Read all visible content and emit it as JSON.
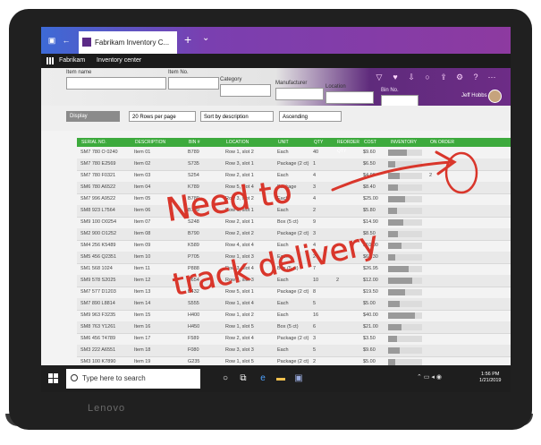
{
  "device": {
    "brand": "Lenovo"
  },
  "browser": {
    "tab_title": "Fabrikam Inventory C...",
    "new_tab": "+",
    "tab_list": "⌄"
  },
  "app": {
    "name": "Fabrikam",
    "page": "Inventory center"
  },
  "filters": {
    "item_name_label": "Item name",
    "item_no_label": "Item No.",
    "category_label": "Category",
    "manufacturer_label": "Manufacturer",
    "location_label": "Location",
    "bin_no_label": "Bin No.",
    "user": "Jeff Hobbs"
  },
  "toolbar": {
    "display": "Display",
    "rows_per_page": "20 Rows per page",
    "sort_by": "Sort by description",
    "order": "Ascending"
  },
  "table": {
    "columns": [
      "Serial No.",
      "Description",
      "Bin #",
      "Location",
      "Unit",
      "Qty",
      "Reorder Qty",
      "Cost",
      "Inventory",
      "On Order"
    ],
    "rows": [
      {
        "serial": "SM7 780 O 0240",
        "desc": "Item 01",
        "bin": "B789",
        "loc": "Row 1, slot 2",
        "unit": "Each",
        "qty": "40",
        "reorder": "",
        "cost": "$9.60",
        "inventory": 0.55,
        "on_order": ""
      },
      {
        "serial": "SM7 780 E2569",
        "desc": "Item 02",
        "bin": "S735",
        "loc": "Row 3, slot 1",
        "unit": "Package (2 ct)",
        "qty": "1",
        "reorder": "",
        "cost": "$6.50",
        "inventory": 0.2,
        "on_order": ""
      },
      {
        "serial": "SM7 780 F0321",
        "desc": "Item 03",
        "bin": "S254",
        "loc": "Row 2, slot 1",
        "unit": "Each",
        "qty": "4",
        "reorder": "",
        "cost": "$4.99",
        "inventory": 0.35,
        "on_order": "2"
      },
      {
        "serial": "SM6 780 A6522",
        "desc": "Item 04",
        "bin": "K789",
        "loc": "Row 5, slot 4",
        "unit": "Package",
        "qty": "3",
        "reorder": "",
        "cost": "$8.40",
        "inventory": 0.3,
        "on_order": ""
      },
      {
        "serial": "SM7 996 A9522",
        "desc": "Item 05",
        "bin": "B789",
        "loc": "Row 3, slot 2",
        "unit": "Each",
        "qty": "4",
        "reorder": "",
        "cost": "$25.00",
        "inventory": 0.5,
        "on_order": ""
      },
      {
        "serial": "SM8 923 L7564",
        "desc": "Item 06",
        "bin": "B799",
        "loc": "Row 1, slot 1",
        "unit": "Each",
        "qty": "2",
        "reorder": "",
        "cost": "$5.80",
        "inventory": 0.25,
        "on_order": ""
      },
      {
        "serial": "SM9 100 O0254",
        "desc": "Item 07",
        "bin": "S248",
        "loc": "Row 2, slot 1",
        "unit": "Box (5 ct)",
        "qty": "9",
        "reorder": "",
        "cost": "$14.90",
        "inventory": 0.45,
        "on_order": ""
      },
      {
        "serial": "SM2 900 O1252",
        "desc": "Item 08",
        "bin": "B790",
        "loc": "Row 2, slot 2",
        "unit": "Package (2 ct)",
        "qty": "3",
        "reorder": "",
        "cost": "$8.50",
        "inventory": 0.3,
        "on_order": ""
      },
      {
        "serial": "SM4 256 K5489",
        "desc": "Item 09",
        "bin": "K589",
        "loc": "Row 4, slot 4",
        "unit": "Each",
        "qty": "4",
        "reorder": "",
        "cost": "$10.00",
        "inventory": 0.4,
        "on_order": ""
      },
      {
        "serial": "SM5 456 Q2351",
        "desc": "Item 10",
        "bin": "P705",
        "loc": "Row 1, slot 3",
        "unit": "Each",
        "qty": "2",
        "reorder": "",
        "cost": "$67.30",
        "inventory": 0.2,
        "on_order": ""
      },
      {
        "serial": "SM1 568 1024",
        "desc": "Item 11",
        "bin": "P888",
        "loc": "Row 3, slot 4",
        "unit": "Box (5 ct)",
        "qty": "7",
        "reorder": "",
        "cost": "$26.95",
        "inventory": 0.6,
        "on_order": ""
      },
      {
        "serial": "SM9 578 S2025",
        "desc": "Item 12",
        "bin": "B654",
        "loc": "Row 4, slot 3",
        "unit": "Each",
        "qty": "10",
        "reorder": "2",
        "cost": "$12.00",
        "inventory": 0.7,
        "on_order": ""
      },
      {
        "serial": "SM7 577 D1203",
        "desc": "Item 13",
        "bin": "B432",
        "loc": "Row 5, slot 1",
        "unit": "Package (2 ct)",
        "qty": "8",
        "reorder": "",
        "cost": "$19.50",
        "inventory": 0.5,
        "on_order": ""
      },
      {
        "serial": "SM7 890 L8814",
        "desc": "Item 14",
        "bin": "S555",
        "loc": "Row 1, slot 4",
        "unit": "Each",
        "qty": "5",
        "reorder": "",
        "cost": "$5.00",
        "inventory": 0.35,
        "on_order": ""
      },
      {
        "serial": "SM9 963 F3235",
        "desc": "Item 15",
        "bin": "H400",
        "loc": "Row 1, slot 2",
        "unit": "Each",
        "qty": "16",
        "reorder": "",
        "cost": "$40.00",
        "inventory": 0.8,
        "on_order": ""
      },
      {
        "serial": "SM8 763 Y1261",
        "desc": "Item 16",
        "bin": "H450",
        "loc": "Row 1, slot 5",
        "unit": "Box (5 ct)",
        "qty": "6",
        "reorder": "",
        "cost": "$21.00",
        "inventory": 0.4,
        "on_order": ""
      },
      {
        "serial": "SM6 456 T4789",
        "desc": "Item 17",
        "bin": "F589",
        "loc": "Row 2, slot 4",
        "unit": "Package (2 ct)",
        "qty": "3",
        "reorder": "",
        "cost": "$3.50",
        "inventory": 0.25,
        "on_order": ""
      },
      {
        "serial": "SM3 222 A6551",
        "desc": "Item 18",
        "bin": "F080",
        "loc": "Row 3, slot 3",
        "unit": "Each",
        "qty": "5",
        "reorder": "",
        "cost": "$9.60",
        "inventory": 0.35,
        "on_order": ""
      },
      {
        "serial": "SM3 100 K7890",
        "desc": "Item 19",
        "bin": "G235",
        "loc": "Row 1, slot 5",
        "unit": "Package (2 ct)",
        "qty": "2",
        "reorder": "",
        "cost": "$5.00",
        "inventory": 0.2,
        "on_order": ""
      }
    ]
  },
  "taskbar": {
    "search_placeholder": "Type here to search",
    "time": "1:56 PM",
    "date": "1/21/2019"
  },
  "annotation": {
    "line1": "Need to",
    "line2": "track delivery",
    "color": "#d9362b"
  },
  "colors": {
    "header_green": "#3daa3d",
    "accent_purple": "#6d2c86"
  }
}
